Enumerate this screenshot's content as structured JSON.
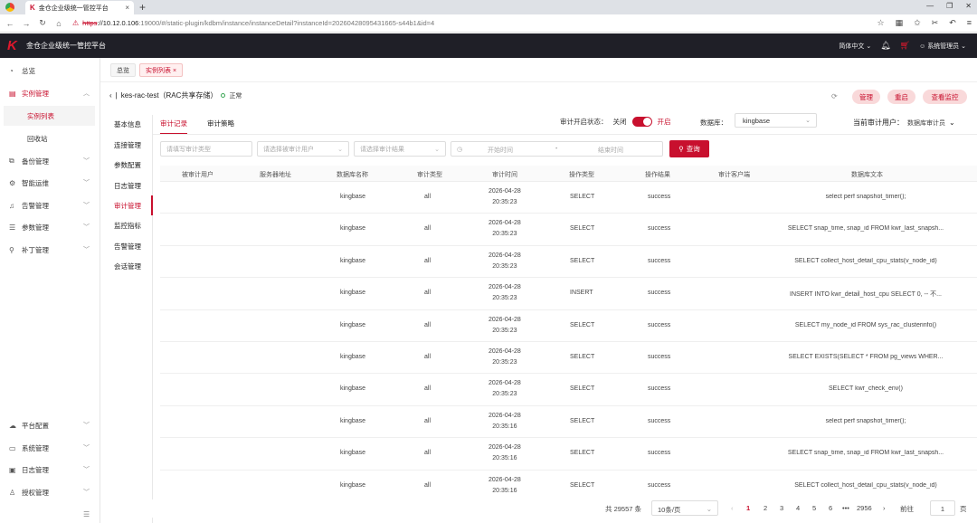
{
  "browser": {
    "tab_title": "金仓企业级统一管控平台",
    "url_https": "https",
    "url_host": "://10.12.0.106",
    "url_path": ":19000/#/static-plugin/kdbm/instance/instanceDetail?instanceId=20260428095431665-s44b1&id=4"
  },
  "header": {
    "title": "金仓企业级统一管控平台",
    "language": "简体中文",
    "user": "系统管理员"
  },
  "sidebar": {
    "items": [
      {
        "label": "总览",
        "icon": "dashboard-icon"
      },
      {
        "label": "实例管理",
        "icon": "instance-icon"
      },
      {
        "label": "实例列表"
      },
      {
        "label": "回收站"
      },
      {
        "label": "备份管理",
        "icon": "backup-icon"
      },
      {
        "label": "智能运维",
        "icon": "ops-icon"
      },
      {
        "label": "告警管理",
        "icon": "bell-icon"
      },
      {
        "label": "参数管理",
        "icon": "list-icon"
      },
      {
        "label": "补丁管理",
        "icon": "wrench-icon"
      },
      {
        "label": "平台配置",
        "icon": "cloud-icon"
      },
      {
        "label": "系统管理",
        "icon": "monitor-icon"
      },
      {
        "label": "日志管理",
        "icon": "log-icon"
      },
      {
        "label": "授权管理",
        "icon": "license-icon"
      }
    ]
  },
  "tags": [
    {
      "label": "总览"
    },
    {
      "label": "实例列表 ×"
    }
  ],
  "instance": {
    "name": "kes-rac-test（RAC共享存储）",
    "status": "正常"
  },
  "actions": {
    "manage": "管理",
    "restart": "重启",
    "monitor": "查看监控"
  },
  "subnav": [
    "基本信息",
    "连接管理",
    "参数配置",
    "日志管理",
    "审计管理",
    "监控指标",
    "告警管理",
    "会话管理"
  ],
  "tabs": [
    "审计记录",
    "审计策略"
  ],
  "audit": {
    "status_label": "审计开启状态：",
    "off": "关闭",
    "on": "开启",
    "db_label": "数据库：",
    "db_value": "kingbase",
    "current_user_label": "当前审计用户：",
    "current_user_value": "数据库审计员"
  },
  "filters": {
    "audit_type": "请填写审计类型",
    "audited_user": "请选择被审计用户",
    "audit_result": "请选择审计结果",
    "start_time": "开始时间",
    "separator": "-",
    "end_time": "结束时间",
    "query": "查询"
  },
  "table": {
    "columns": [
      "被审计用户",
      "服务器地址",
      "数据库名称",
      "审计类型",
      "审计时间",
      "操作类型",
      "操作结果",
      "审计客户端",
      "数据库文本"
    ],
    "rows": [
      {
        "db": "kingbase",
        "type": "all",
        "date": "2026-04-28",
        "time": "20:35:23",
        "op": "SELECT",
        "result": "success",
        "sql": "select perf snapshot_timer();"
      },
      {
        "db": "kingbase",
        "type": "all",
        "date": "2026-04-28",
        "time": "20:35:23",
        "op": "SELECT",
        "result": "success",
        "sql": "SELECT snap_time, snap_id FROM kwr_last_snapsh..."
      },
      {
        "db": "kingbase",
        "type": "all",
        "date": "2026-04-28",
        "time": "20:35:23",
        "op": "SELECT",
        "result": "success",
        "sql": "SELECT collect_host_detail_cpu_stats(v_node_id)"
      },
      {
        "db": "kingbase",
        "type": "all",
        "date": "2026-04-28",
        "time": "20:35:23",
        "op": "INSERT",
        "result": "success",
        "sql": "INSERT INTO kwr_detail_host_cpu SELECT 0, -- 不..."
      },
      {
        "db": "kingbase",
        "type": "all",
        "date": "2026-04-28",
        "time": "20:35:23",
        "op": "SELECT",
        "result": "success",
        "sql": "SELECT my_node_id FROM sys_rac_clusterinfo()"
      },
      {
        "db": "kingbase",
        "type": "all",
        "date": "2026-04-28",
        "time": "20:35:23",
        "op": "SELECT",
        "result": "success",
        "sql": "SELECT EXISTS(SELECT * FROM pg_views WHER..."
      },
      {
        "db": "kingbase",
        "type": "all",
        "date": "2026-04-28",
        "time": "20:35:23",
        "op": "SELECT",
        "result": "success",
        "sql": "SELECT kwr_check_env()"
      },
      {
        "db": "kingbase",
        "type": "all",
        "date": "2026-04-28",
        "time": "20:35:16",
        "op": "SELECT",
        "result": "success",
        "sql": "select perf snapshot_timer();"
      },
      {
        "db": "kingbase",
        "type": "all",
        "date": "2026-04-28",
        "time": "20:35:16",
        "op": "SELECT",
        "result": "success",
        "sql": "SELECT snap_time, snap_id FROM kwr_last_snapsh..."
      },
      {
        "db": "kingbase",
        "type": "all",
        "date": "2026-04-28",
        "time": "20:35:16",
        "op": "SELECT",
        "result": "success",
        "sql": "SELECT collect_host_detail_cpu_stats(v_node_id)"
      }
    ]
  },
  "pager": {
    "total": "共 29557 条",
    "page_size": "10条/页",
    "pages": [
      "1",
      "2",
      "3",
      "4",
      "5",
      "6",
      "•••",
      "2956"
    ],
    "goto": "前往",
    "goto_value": "1",
    "page_unit": "页"
  }
}
